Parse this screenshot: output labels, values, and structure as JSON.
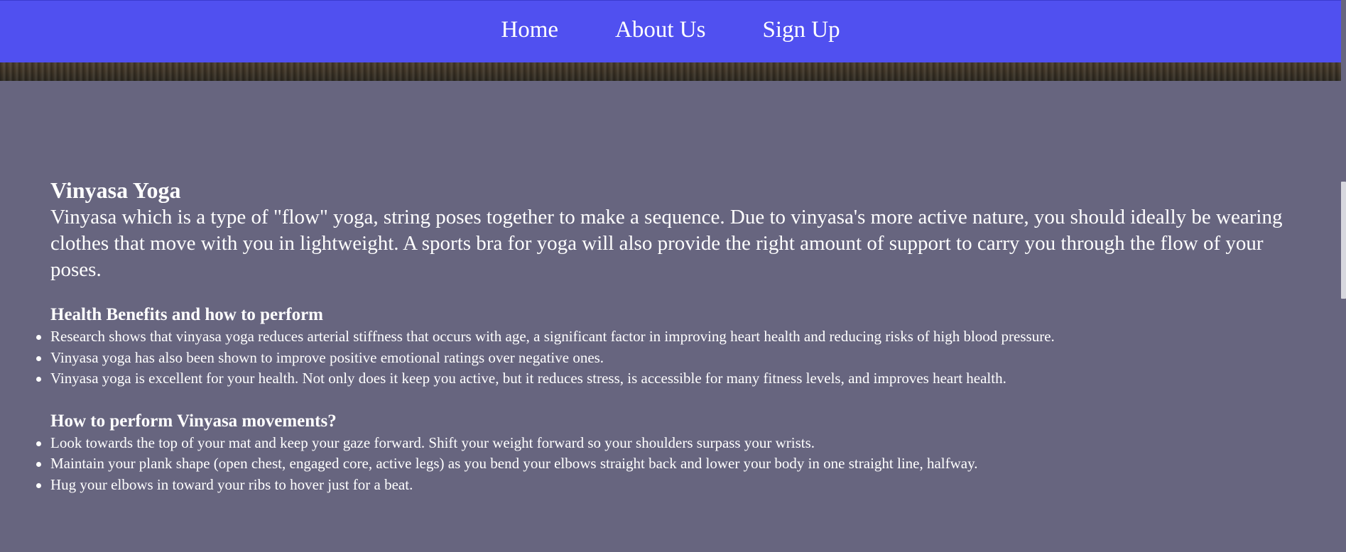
{
  "nav": {
    "items": [
      {
        "label": "Home"
      },
      {
        "label": "About Us"
      },
      {
        "label": "Sign Up"
      }
    ]
  },
  "main": {
    "title": "Vinyasa Yoga",
    "intro": "Vinyasa which is a type of \"flow\" yoga, string poses together to make a sequence. Due to vinyasa's more active nature, you should ideally be wearing clothes that move with you in lightweight. A sports bra for yoga will also provide the right amount of support to carry you through the flow of your poses.",
    "sections": [
      {
        "heading": "Health Benefits and how to perform",
        "items": [
          "Research shows that vinyasa yoga reduces arterial stiffness that occurs with age, a significant factor in improving heart health and reducing risks of high blood pressure.",
          "Vinyasa yoga has also been shown to improve positive emotional ratings over negative ones.",
          "Vinyasa yoga is excellent for your health. Not only does it keep you active, but it reduces stress, is accessible for many fitness levels, and improves heart health."
        ]
      },
      {
        "heading": "How to perform Vinyasa movements?",
        "items": [
          "Look towards the top of your mat and keep your gaze forward. Shift your weight forward so your shoulders surpass your wrists.",
          "Maintain your plank shape (open chest, engaged core, active legs) as you bend your elbows straight back and lower your body in one straight line, halfway.",
          "Hug your elbows in toward your ribs to hover just for a beat."
        ]
      }
    ]
  },
  "colors": {
    "navbar": "#5050f0",
    "background": "#67657f",
    "text": "#ffffff"
  }
}
